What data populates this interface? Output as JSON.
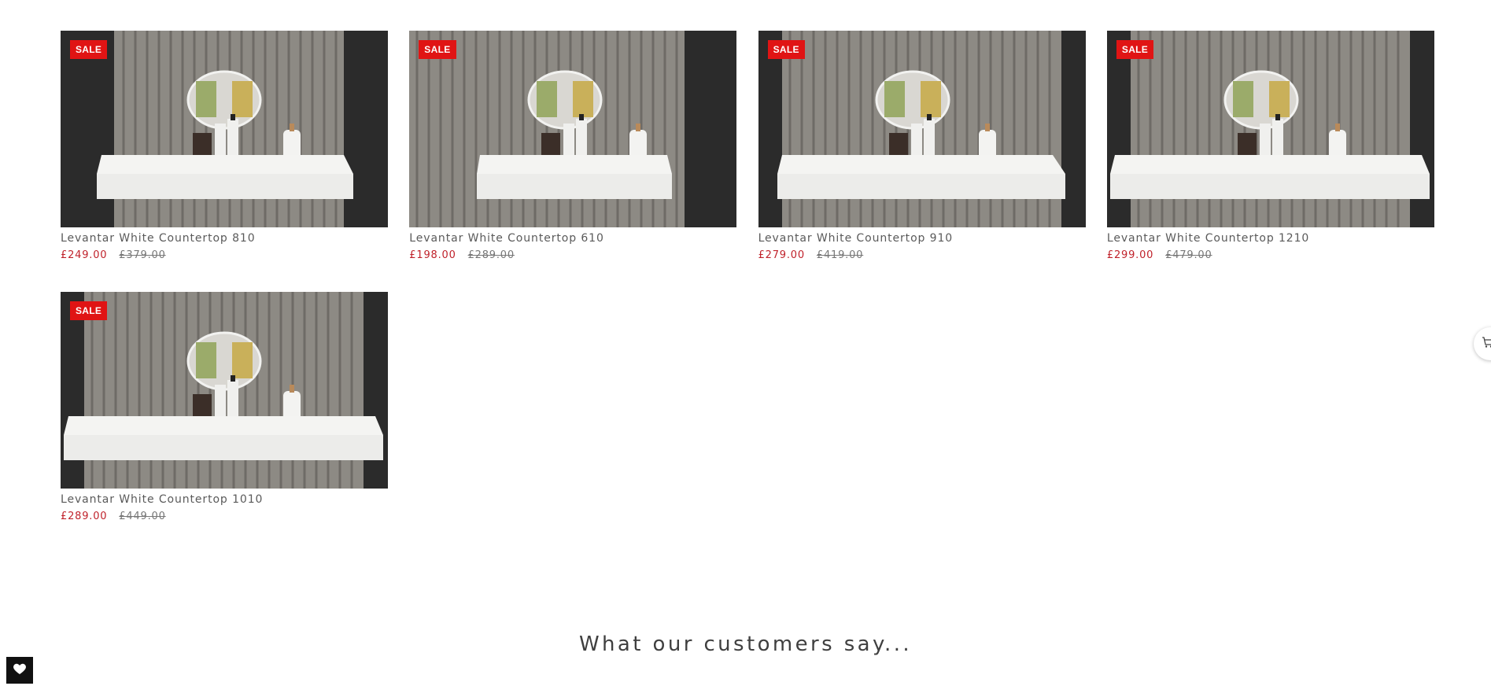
{
  "products": [
    {
      "title": "Levantar White Countertop 810",
      "price": "£249.00",
      "original_price": "£379.00",
      "badge": "SALE"
    },
    {
      "title": "Levantar White Countertop 610",
      "price": "£198.00",
      "original_price": "£289.00",
      "badge": "SALE"
    },
    {
      "title": "Levantar White Countertop 910",
      "price": "£279.00",
      "original_price": "£419.00",
      "badge": "SALE"
    },
    {
      "title": "Levantar White Countertop 1210",
      "price": "£299.00",
      "original_price": "£479.00",
      "badge": "SALE"
    },
    {
      "title": "Levantar White Countertop 1010",
      "price": "£289.00",
      "original_price": "£449.00",
      "badge": "SALE"
    }
  ],
  "testimonials": {
    "heading": "What our customers say..."
  },
  "colors": {
    "sale_badge": "#e01414",
    "sale_price": "#c0222b",
    "background": "#ffffff"
  },
  "icons": {
    "cart": "cart-icon",
    "wishlist": "heart-icon"
  }
}
